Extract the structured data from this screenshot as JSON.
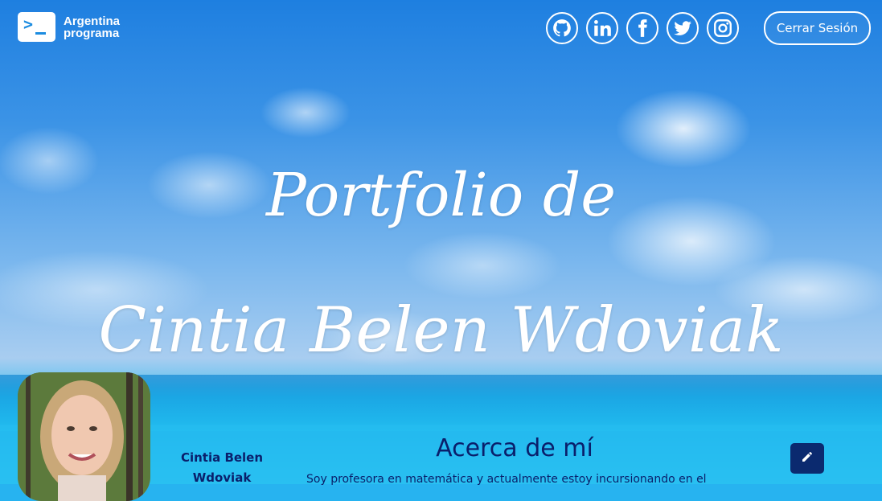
{
  "header": {
    "logo_line1": "Argentina",
    "logo_line2": "programa",
    "socials": [
      {
        "name": "github-icon"
      },
      {
        "name": "linkedin-icon"
      },
      {
        "name": "facebook-icon"
      },
      {
        "name": "twitter-icon"
      },
      {
        "name": "instagram-icon"
      }
    ],
    "logout_label": "Cerrar Sesión"
  },
  "hero": {
    "title_line1": "Portfolio de",
    "title_line2": "Cintia Belen Wdoviak"
  },
  "profile": {
    "name_line1": "Cintia Belen",
    "name_line2": "Wdoviak"
  },
  "about": {
    "title": "Acerca de mí",
    "text": "Soy profesora en matemática y actualmente estoy incursionando en el",
    "edit_icon": "pencil-icon"
  },
  "colors": {
    "accent": "#0b2a6f",
    "text_dark": "#0a1f6b",
    "white": "#ffffff"
  }
}
